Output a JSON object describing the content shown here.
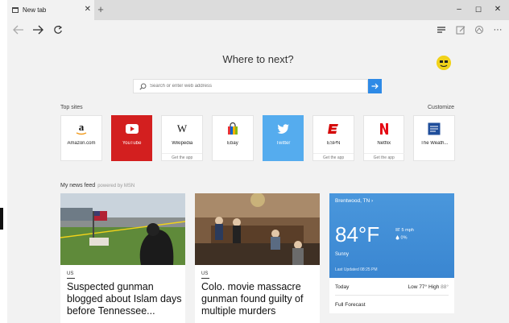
{
  "tab": {
    "title": "New tab",
    "close": "✕",
    "new": "+"
  },
  "window_controls": {
    "minimize": "–",
    "maximize": "☐",
    "close": "✕"
  },
  "toolbar": {
    "more": "···"
  },
  "heading": "Where to next?",
  "search": {
    "placeholder": "Search or enter web address"
  },
  "top_sites": {
    "label": "Top sites",
    "customize": "Customize",
    "tiles": [
      {
        "label": "Amazon.com",
        "sub": ""
      },
      {
        "label": "YouTube",
        "sub": ""
      },
      {
        "label": "Wikipedia",
        "sub": "Get the app"
      },
      {
        "label": "Ebay",
        "sub": ""
      },
      {
        "label": "Twitter",
        "sub": ""
      },
      {
        "label": "ESPN",
        "sub": "Get the app"
      },
      {
        "label": "Netflix",
        "sub": "Get the app"
      },
      {
        "label": "The Weath...",
        "sub": ""
      }
    ],
    "colors": {
      "youtube": "#d31f1f",
      "twitter": "#55acee",
      "espn": "#d50a0a",
      "netflix": "#e50914"
    }
  },
  "feed": {
    "label": "My news feed",
    "powered": "powered by MSN",
    "articles": [
      {
        "category": "US",
        "title": "Suspected gunman blogged about Islam days before Tennessee..."
      },
      {
        "category": "US",
        "title": "Colo. movie massacre gunman found guilty of multiple murders"
      }
    ]
  },
  "weather": {
    "location": "Brentwood, TN",
    "chevron": "›",
    "temperature": "84°F",
    "wind": "5 mph",
    "precip": "0%",
    "condition": "Sunny",
    "updated": "Last Updated 08:25 PM",
    "today_label": "Today",
    "low_label": "Low",
    "low": "77°",
    "high_label": "High",
    "high": "88°",
    "forecast_label": "Full Forecast"
  }
}
